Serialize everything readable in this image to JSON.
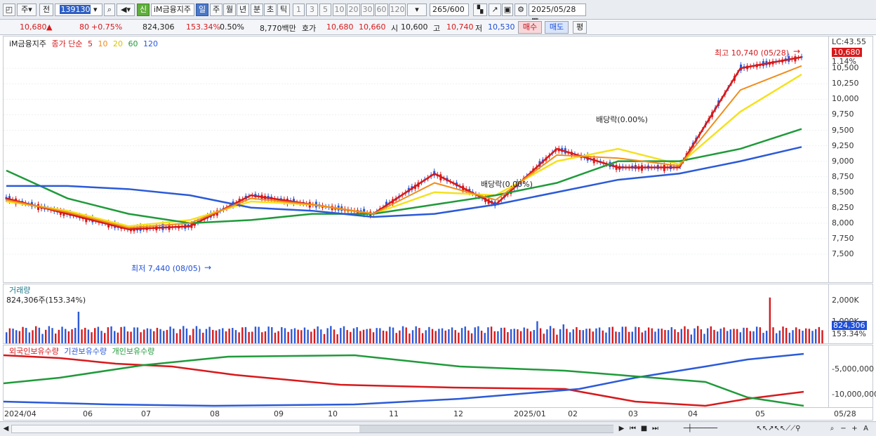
{
  "toolbar": {
    "market": "주",
    "prev_label": "전",
    "code": "139130",
    "new_label": "신",
    "stock_name": "iM금융지주",
    "periods": [
      "일",
      "주",
      "월",
      "년",
      "분",
      "초",
      "틱"
    ],
    "intervals": [
      "1",
      "3",
      "5",
      "10",
      "20",
      "30",
      "60",
      "120"
    ],
    "count": "265",
    "max_count": "/600",
    "date": "2025/05/28"
  },
  "quote": {
    "price": "10,680",
    "change_arrow": "▲",
    "change": "80",
    "change_pct": "+0.75%",
    "volume": "824,306",
    "vol_ratio": "153.34%",
    "turnover": "0.50%",
    "amount": "8,770백만",
    "bid_label": "호가",
    "ask": "10,680",
    "bid": "10,660",
    "open_label": "시",
    "open": "10,600",
    "high_label": "고",
    "high": "10,740",
    "low_label": "저",
    "low": "10,530",
    "buy_label": "매수",
    "sell_label": "매도",
    "avg_label": "평"
  },
  "price_panel": {
    "legend_name": "iM금융지주",
    "legend_series": "종가 단순",
    "ma_labels": [
      "5",
      "10",
      "20",
      "60",
      "120"
    ],
    "ma_colors": [
      "#d7191c",
      "#f08c1a",
      "#f5e11d",
      "#1f9a3a",
      "#2b5ad8"
    ],
    "lc_label": "LC:43.55",
    "current_badge": "10,680",
    "pct_badge": "1.14%",
    "axis_ticks": [
      "10,500",
      "10,250",
      "10,000",
      "9,750",
      "9,500",
      "9,250",
      "9,000",
      "8,750",
      "8,500",
      "8,250",
      "8,000",
      "7,750",
      "7,500"
    ],
    "high_annotation": "최고 10,740 (05/28)",
    "low_annotation": "최저 7,440 (08/05)",
    "drop_annotations": [
      "배당락(0.00%)",
      "배당락(0.00%)"
    ]
  },
  "volume_panel": {
    "title": "거래량",
    "value_label": "824,306주(153.34%)",
    "axis_ticks": [
      "2,000K",
      "1,000K"
    ],
    "current_badge": "824,306",
    "pct_badge": "153.34%"
  },
  "holding_panel": {
    "legends": [
      "외국인보유수량",
      "기관보유수량",
      "개인보유수량"
    ],
    "colors": [
      "#d7191c",
      "#2b5ad8",
      "#1f9a3a"
    ],
    "axis_ticks": [
      "-5,000,000",
      "-10,000,000"
    ]
  },
  "dates": [
    "2024/04",
    "06",
    "07",
    "08",
    "09",
    "10",
    "11",
    "12",
    "2025/01",
    "02",
    "03",
    "04",
    "05"
  ],
  "last_date": "05/28",
  "chart_data": {
    "type": "line",
    "title": "",
    "x": [
      "2024/04",
      "06",
      "07",
      "08",
      "09",
      "10",
      "11",
      "12",
      "2025/01",
      "02",
      "03",
      "04",
      "05",
      "05/28"
    ],
    "ylim": [
      7250,
      10900
    ],
    "series": [
      {
        "name": "5",
        "values": [
          8400,
          8150,
          7900,
          7950,
          8450,
          8300,
          8150,
          8800,
          8300,
          9200,
          8900,
          8900,
          10500,
          10680
        ]
      },
      {
        "name": "20",
        "values": [
          8350,
          8200,
          7950,
          8050,
          8350,
          8300,
          8150,
          8500,
          8450,
          9000,
          9200,
          8950,
          9800,
          10400
        ]
      },
      {
        "name": "60",
        "values": [
          8850,
          8400,
          8150,
          8000,
          8050,
          8150,
          8150,
          8300,
          8450,
          8650,
          9000,
          9000,
          9200,
          9520
        ]
      },
      {
        "name": "120",
        "values": [
          8600,
          8600,
          8550,
          8450,
          8250,
          8200,
          8100,
          8150,
          8300,
          8500,
          8700,
          8800,
          9000,
          9230
        ]
      }
    ],
    "high": 10740,
    "low": 7440
  }
}
